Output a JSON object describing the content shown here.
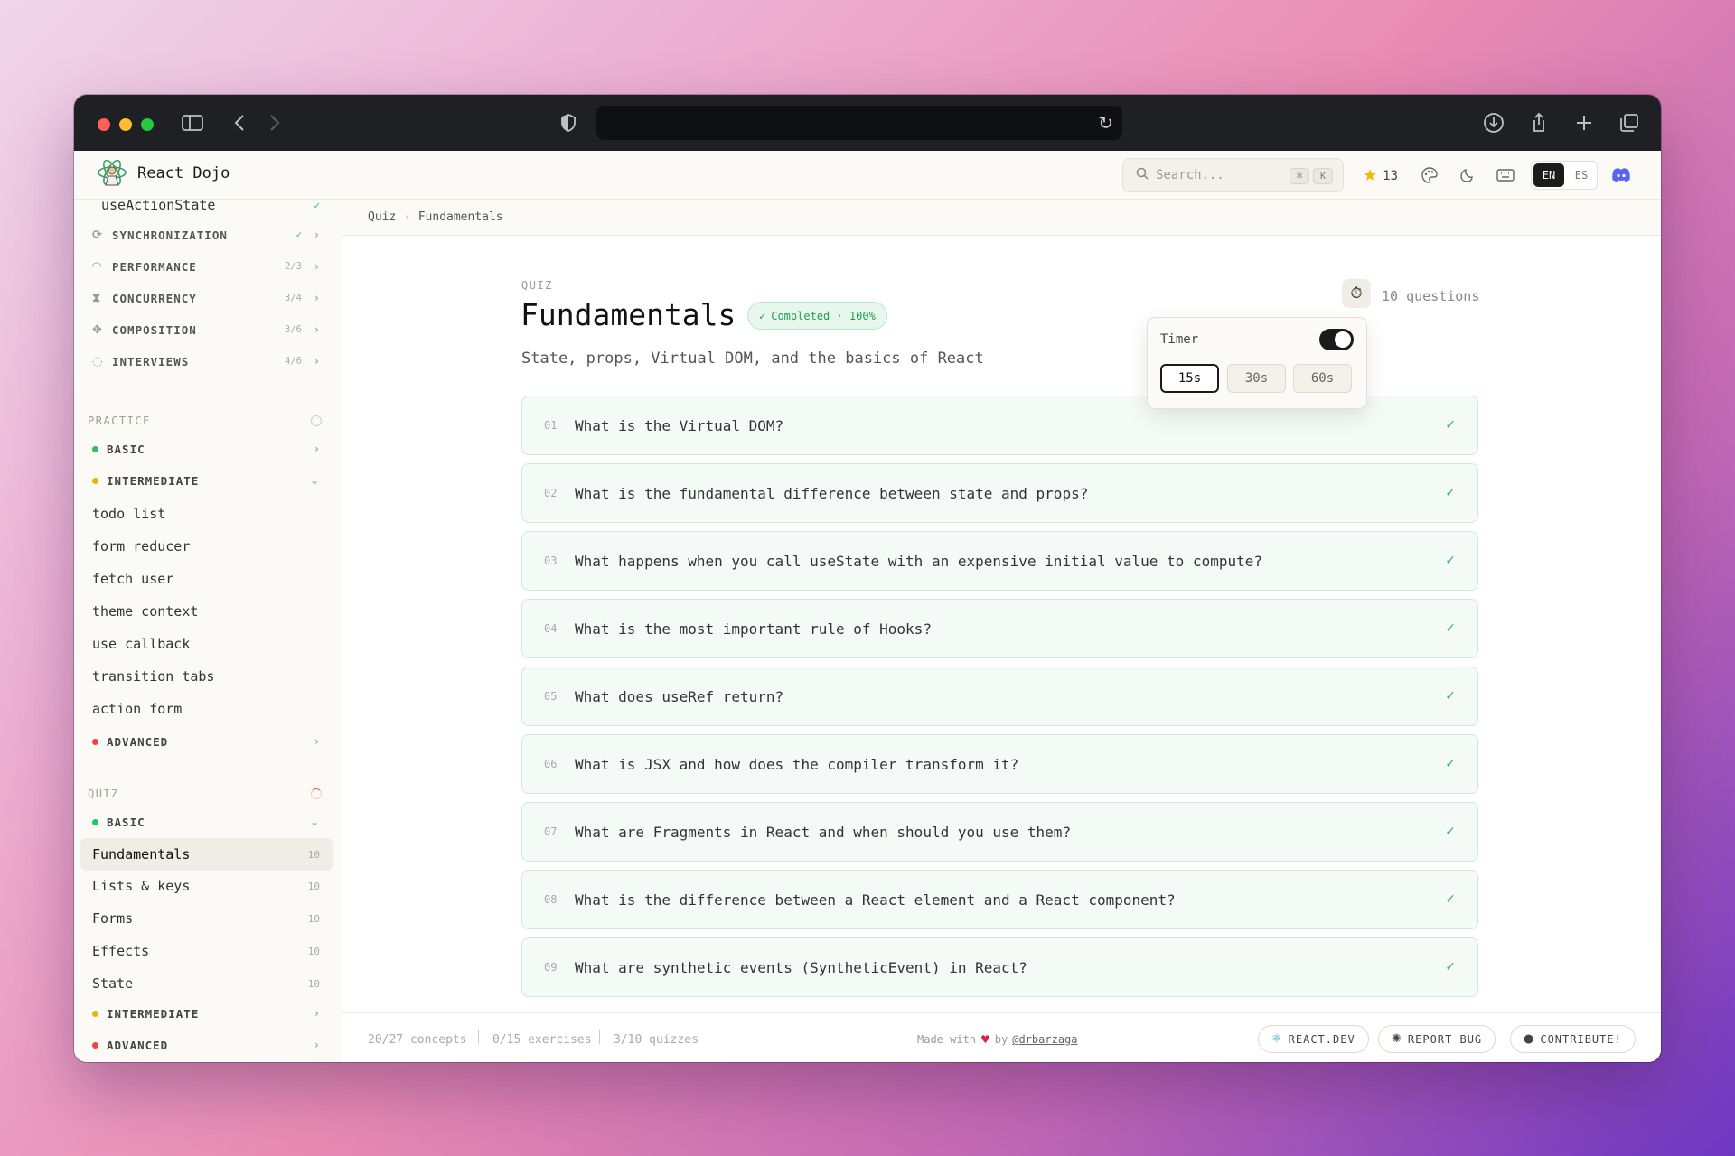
{
  "app": {
    "brand": "React Dojo",
    "search_placeholder": "Search...",
    "search_kbd_1": "⌘",
    "search_kbd_2": "K",
    "stars": "13",
    "lang_en": "EN",
    "lang_es": "ES"
  },
  "sidebar": {
    "partial_item": "useActionState",
    "sections": [
      {
        "label": "SYNCHRONIZATION",
        "count": "✓",
        "icon": "sync-icon"
      },
      {
        "label": "PERFORMANCE",
        "count": "2/3",
        "icon": "gauge-icon"
      },
      {
        "label": "CONCURRENCY",
        "count": "3/4",
        "icon": "hourglass-icon"
      },
      {
        "label": "COMPOSITION",
        "count": "3/6",
        "icon": "puzzle-icon"
      },
      {
        "label": "INTERVIEWS",
        "count": "4/6",
        "icon": "chat-icon"
      }
    ],
    "practice": {
      "title": "PRACTICE",
      "levels": [
        {
          "label": "BASIC",
          "color": "#22c55e"
        },
        {
          "label": "INTERMEDIATE",
          "color": "#eab308"
        },
        {
          "label": "ADVANCED",
          "color": "#ef4444"
        }
      ],
      "items": [
        "todo list",
        "form reducer",
        "fetch user",
        "theme context",
        "use callback",
        "transition tabs",
        "action form"
      ]
    },
    "quiz": {
      "title": "QUIZ",
      "levels": [
        {
          "label": "BASIC",
          "color": "#22c55e"
        },
        {
          "label": "INTERMEDIATE",
          "color": "#eab308"
        },
        {
          "label": "ADVANCED",
          "color": "#ef4444"
        }
      ],
      "items": [
        {
          "label": "Fundamentals",
          "count": "10"
        },
        {
          "label": "Lists & keys",
          "count": "10"
        },
        {
          "label": "Forms",
          "count": "10"
        },
        {
          "label": "Effects",
          "count": "10"
        },
        {
          "label": "State",
          "count": "10"
        }
      ]
    }
  },
  "breadcrumb": [
    "Quiz",
    "Fundamentals"
  ],
  "quiz": {
    "eyebrow": "QUIZ",
    "title": "Fundamentals",
    "badge": "Completed · 100%",
    "subtitle": "State, props, Virtual DOM, and the basics of React",
    "question_count": "10 questions",
    "timer": {
      "label": "Timer",
      "enabled": true,
      "options": [
        "15s",
        "30s",
        "60s"
      ],
      "selected": "15s"
    },
    "questions": [
      {
        "num": "01",
        "text": "What is the Virtual DOM?"
      },
      {
        "num": "02",
        "text": "What is the fundamental difference between state and props?"
      },
      {
        "num": "03",
        "text": "What happens when you call useState with an expensive initial value to compute?"
      },
      {
        "num": "04",
        "text": "What is the most important rule of Hooks?"
      },
      {
        "num": "05",
        "text": "What does useRef return?"
      },
      {
        "num": "06",
        "text": "What is JSX and how does the compiler transform it?"
      },
      {
        "num": "07",
        "text": "What are Fragments in React and when should you use them?"
      },
      {
        "num": "08",
        "text": "What is the difference between a React element and a React component?"
      },
      {
        "num": "09",
        "text": "What are synthetic events (SyntheticEvent) in React?"
      }
    ]
  },
  "footer": {
    "concepts": "20/27 concepts",
    "exercises": "0/15 exercises",
    "quizzes": "3/10 quizzes",
    "made_with": "Made with",
    "by": "by",
    "handle": "@drbarzaga",
    "btn_react": "REACT.DEV",
    "btn_bug": "REPORT BUG",
    "btn_contribute": "CONTRIBUTE!"
  }
}
